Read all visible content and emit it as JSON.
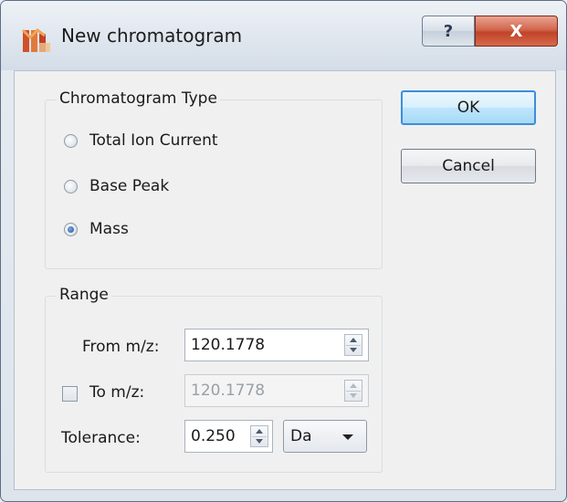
{
  "window": {
    "title": "New chromatogram",
    "help_glyph": "?",
    "close_glyph": "X"
  },
  "chromatogram_type": {
    "group_title": "Chromatogram Type",
    "options": [
      {
        "label": "Total Ion Current",
        "checked": false
      },
      {
        "label": "Base Peak",
        "checked": false
      },
      {
        "label": "Mass",
        "checked": true
      }
    ]
  },
  "range": {
    "group_title": "Range",
    "from_label": "From m/z:",
    "from_value": "120.1778",
    "to_label": "To m/z:",
    "to_value": "120.1778",
    "to_enabled": false,
    "tolerance_label": "Tolerance:",
    "tolerance_value": "0.250",
    "unit_selected": "Da"
  },
  "buttons": {
    "ok": "OK",
    "cancel": "Cancel"
  },
  "colors": {
    "default_button_border": "#3c8edb",
    "close_button": "#c0432a"
  }
}
